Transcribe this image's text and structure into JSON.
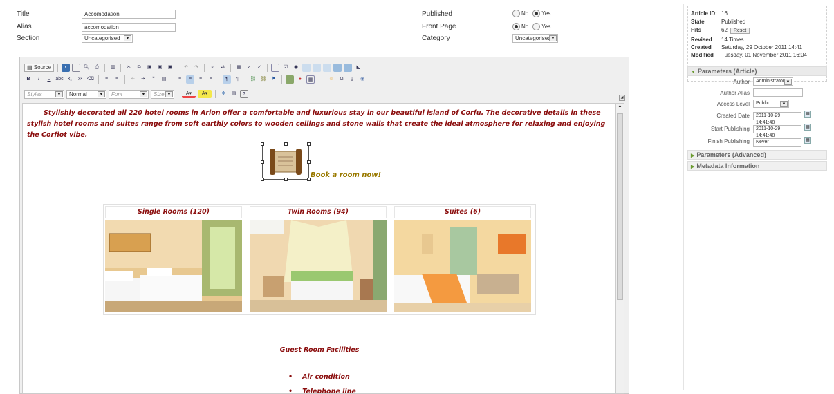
{
  "form": {
    "title_label": "Title",
    "title_value": "Accomodation",
    "alias_label": "Alias",
    "alias_value": "accomodation",
    "section_label": "Section",
    "section_value": "Uncategorised",
    "published_label": "Published",
    "published_no": "No",
    "published_yes": "Yes",
    "frontpage_label": "Front Page",
    "frontpage_no": "No",
    "frontpage_yes": "Yes",
    "category_label": "Category",
    "category_value": "Uncategorised"
  },
  "info": {
    "id_label": "Article ID:",
    "id_value": "16",
    "state_label": "State",
    "state_value": "Published",
    "hits_label": "Hits",
    "hits_value": "62",
    "reset_label": "Reset",
    "revised_label": "Revised",
    "revised_value": "14 Times",
    "created_label": "Created",
    "created_value": "Saturday, 29 October 2011 14:41",
    "modified_label": "Modified",
    "modified_value": "Tuesday, 01 November 2011 16:04"
  },
  "params": {
    "header": "Parameters (Article)",
    "author_label": "Author",
    "author_value": "Administrator",
    "alias_label": "Author Alias",
    "alias_value": "",
    "access_label": "Access Level",
    "access_value": "Public",
    "created_label": "Created Date",
    "created_value": "2011-10-29 14:41:48",
    "start_label": "Start Publishing",
    "start_value": "2011-10-29 14:41:48",
    "finish_label": "Finish Publishing",
    "finish_value": "Never",
    "advanced_header": "Parameters (Advanced)",
    "metadata_header": "Metadata Information"
  },
  "toolbar": {
    "source_label": "Source",
    "styles_placeholder": "Styles",
    "format_value": "Normal",
    "font_placeholder": "Font",
    "size_placeholder": "Size"
  },
  "content": {
    "intro": "Stylishly decorated all 220 hotel rooms in Arion offer a comfortable and luxurious stay in our beautiful island of Corfu. The decorative details in these stylish hotel rooms and suites range from soft earthly colors to wooden ceilings and stone walls that create the ideal atmosphere for relaxing and enjoying the Corfiot vibe.",
    "book_link": "Book a room now!",
    "rooms": [
      {
        "title": "Single Rooms (120)"
      },
      {
        "title": "Twin Rooms (94)"
      },
      {
        "title": "Suites (6)"
      }
    ],
    "facilities_title": "Guest Room Facilities",
    "facilities": [
      "Air condition",
      "Telephone line"
    ]
  },
  "colors": {
    "text_red": "#8b0e0e",
    "link_gold": "#9a7a00",
    "accent_green": "#6a9a2e"
  }
}
